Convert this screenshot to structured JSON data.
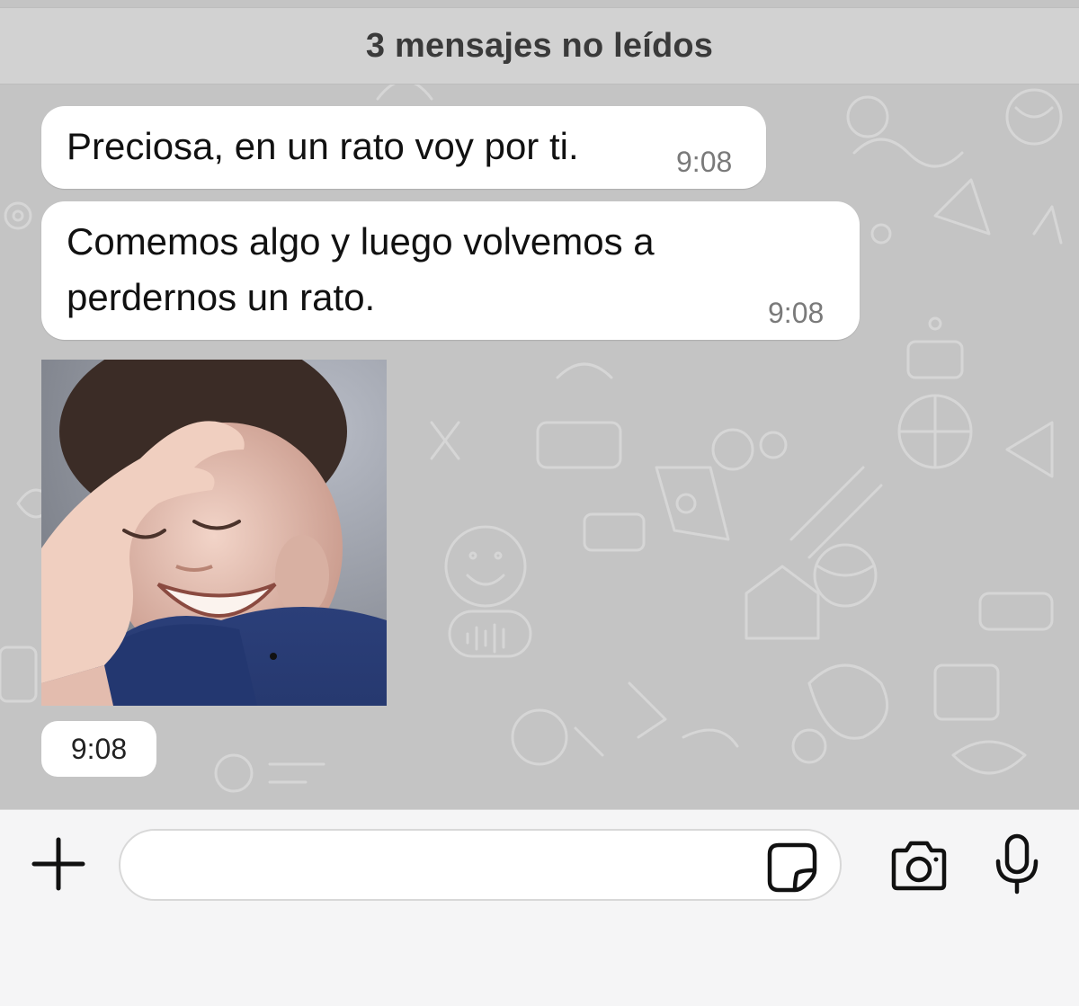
{
  "unread_banner": {
    "label": "3 mensajes no leídos"
  },
  "messages": [
    {
      "text": "Preciosa, en un rato voy por ti.",
      "time": "9:08"
    },
    {
      "line1": "Comemos algo y luego volvemos a",
      "line2": "perdernos un rato.",
      "time": "9:08"
    }
  ],
  "image_message": {
    "time": "9:08"
  },
  "composer": {
    "placeholder": "",
    "icons": {
      "attach": "plus-icon",
      "sticker": "sticker-icon",
      "camera": "camera-icon",
      "microphone": "microphone-icon"
    }
  },
  "colors": {
    "wallpaper": "#c4c4c4",
    "bubble": "#ffffff",
    "composer_bar": "#f5f5f6"
  }
}
